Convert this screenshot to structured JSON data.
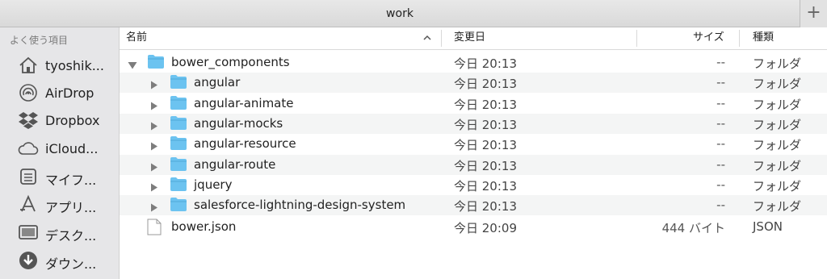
{
  "window": {
    "title": "work",
    "new_tab_label": "+"
  },
  "sidebar": {
    "header": "よく使う項目",
    "items": [
      {
        "label": "tyoshik...",
        "icon": "home-icon"
      },
      {
        "label": "AirDrop",
        "icon": "airdrop-icon"
      },
      {
        "label": "Dropbox",
        "icon": "dropbox-icon"
      },
      {
        "label": "iCloud...",
        "icon": "cloud-icon"
      },
      {
        "label": "マイフ...",
        "icon": "documents-icon"
      },
      {
        "label": "アプリ...",
        "icon": "applications-icon"
      },
      {
        "label": "デスク...",
        "icon": "desktop-icon"
      },
      {
        "label": "ダウン...",
        "icon": "downloads-icon"
      }
    ]
  },
  "columns": {
    "name": "名前",
    "date": "変更日",
    "size": "サイズ",
    "kind": "種類"
  },
  "files": [
    {
      "name": "bower_components",
      "date": "今日 20:13",
      "size": "--",
      "kind": "フォルダ",
      "type": "folder",
      "expanded": true,
      "indent": 0
    },
    {
      "name": "angular",
      "date": "今日 20:13",
      "size": "--",
      "kind": "フォルダ",
      "type": "folder",
      "expanded": false,
      "indent": 1
    },
    {
      "name": "angular-animate",
      "date": "今日 20:13",
      "size": "--",
      "kind": "フォルダ",
      "type": "folder",
      "expanded": false,
      "indent": 1
    },
    {
      "name": "angular-mocks",
      "date": "今日 20:13",
      "size": "--",
      "kind": "フォルダ",
      "type": "folder",
      "expanded": false,
      "indent": 1
    },
    {
      "name": "angular-resource",
      "date": "今日 20:13",
      "size": "--",
      "kind": "フォルダ",
      "type": "folder",
      "expanded": false,
      "indent": 1
    },
    {
      "name": "angular-route",
      "date": "今日 20:13",
      "size": "--",
      "kind": "フォルダ",
      "type": "folder",
      "expanded": false,
      "indent": 1
    },
    {
      "name": "jquery",
      "date": "今日 20:13",
      "size": "--",
      "kind": "フォルダ",
      "type": "folder",
      "expanded": false,
      "indent": 1
    },
    {
      "name": "salesforce-lightning-design-system",
      "date": "今日 20:13",
      "size": "--",
      "kind": "フォルダ",
      "type": "folder",
      "expanded": false,
      "indent": 1
    },
    {
      "name": "bower.json",
      "date": "今日 20:09",
      "size": "444 バイト",
      "kind": "JSON",
      "type": "file",
      "expanded": false,
      "indent": 0
    }
  ],
  "colors": {
    "folder": "#6cc3f0",
    "sidebar_bg": "#e6e6e8",
    "row_alt": "#f4f5f5"
  }
}
